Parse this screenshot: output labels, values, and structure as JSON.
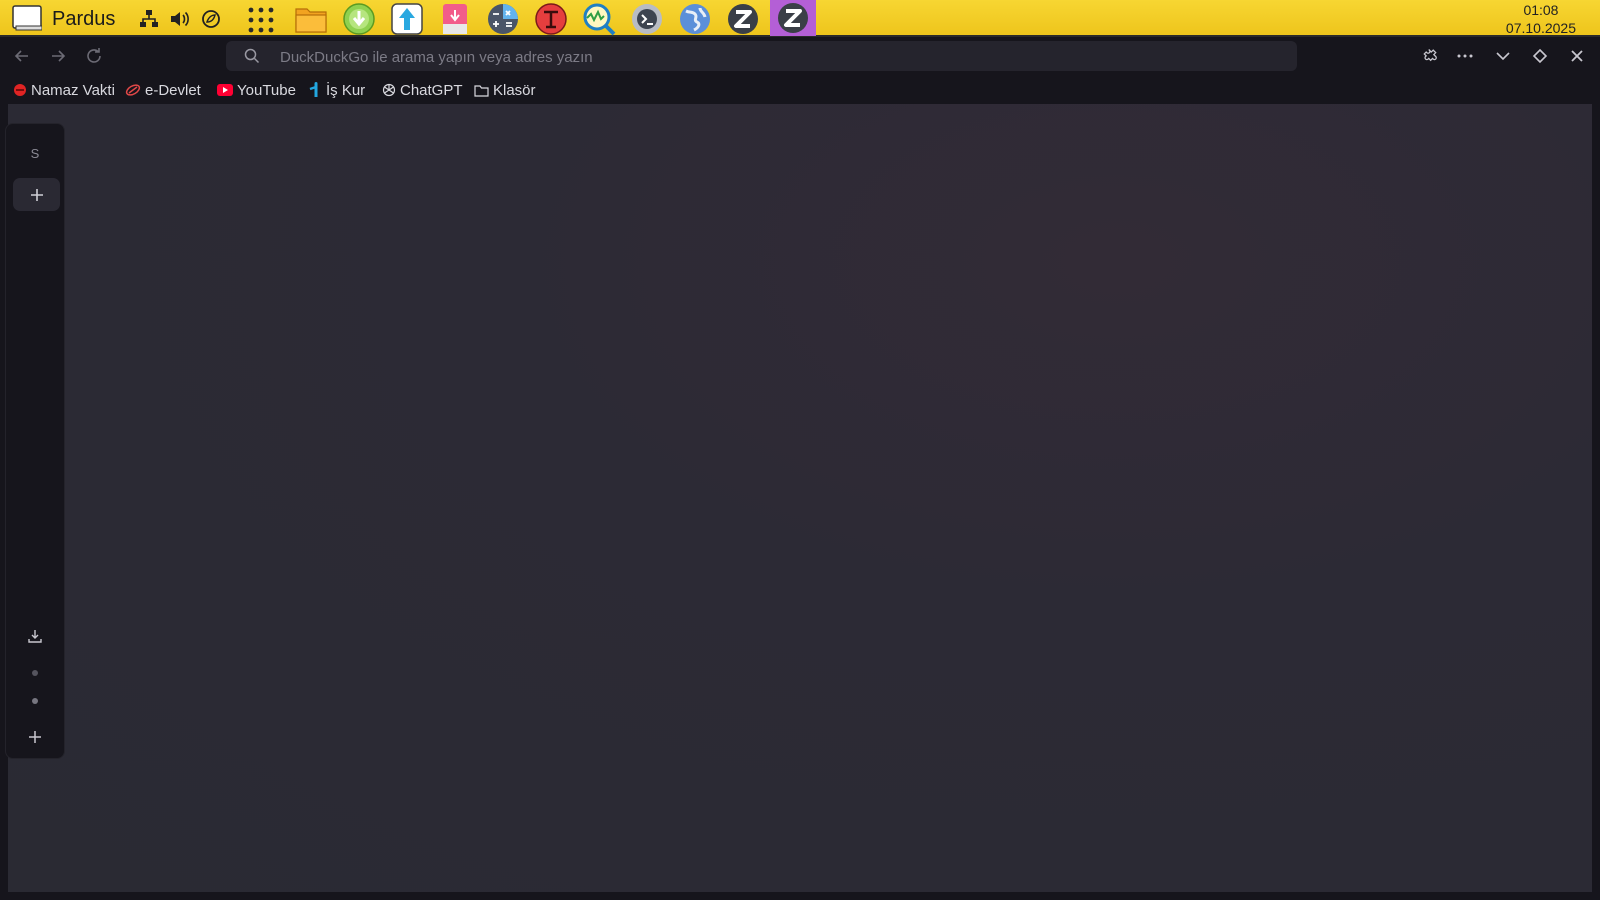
{
  "taskbar": {
    "start_label": "Pardus",
    "tray_icons": [
      "network-icon",
      "volume-icon",
      "power-saver-icon"
    ],
    "apps": [
      "app-grid-icon",
      "file-manager-icon",
      "download-manager-icon",
      "upload-icon",
      "screenshot-tool-icon",
      "calculator-icon",
      "font-manager-icon",
      "system-monitor-icon",
      "terminal-icon",
      "web-browser-icon",
      "zen-browser-icon",
      "zen-browser-active-icon"
    ],
    "clock_time": "01:08",
    "clock_date": "07.10.2025"
  },
  "browser": {
    "url_placeholder": "DuckDuckGo ile arama yapın veya adres yazın",
    "bookmarks": [
      {
        "label": "Namaz Vakti",
        "icon": "red-dot-icon"
      },
      {
        "label": "e-Devlet",
        "icon": "edevlet-icon"
      },
      {
        "label": "YouTube",
        "icon": "youtube-icon"
      },
      {
        "label": "İş Kur",
        "icon": "iskur-icon"
      },
      {
        "label": "ChatGPT",
        "icon": "chatgpt-icon"
      },
      {
        "label": "Klasör",
        "icon": "folder-icon"
      }
    ],
    "sidebar": {
      "workspace_label": "S"
    }
  },
  "colors": {
    "taskbar": "#f2cc24",
    "chrome": "#16151c",
    "content": "#2c2a35",
    "youtube_red": "#ff0033"
  }
}
